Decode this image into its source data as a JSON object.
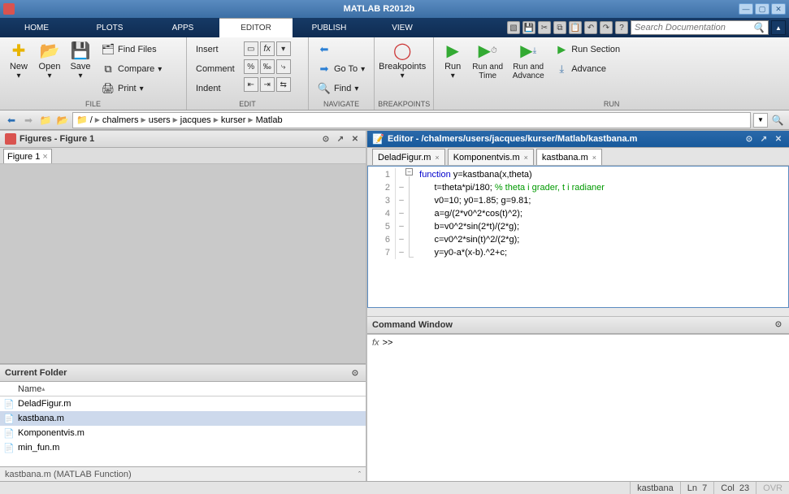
{
  "title": "MATLAB R2012b",
  "tabs": {
    "home": "HOME",
    "plots": "PLOTS",
    "apps": "APPS",
    "editor": "EDITOR",
    "publish": "PUBLISH",
    "view": "VIEW"
  },
  "search": {
    "placeholder": "Search Documentation"
  },
  "ribbon": {
    "file": {
      "new": "New",
      "open": "Open",
      "save": "Save",
      "findfiles": "Find Files",
      "compare": "Compare",
      "print": "Print",
      "label": "FILE"
    },
    "edit": {
      "insert": "Insert",
      "comment": "Comment",
      "indent": "Indent",
      "label": "EDIT"
    },
    "navigate": {
      "goto": "Go To",
      "find": "Find",
      "label": "NAVIGATE"
    },
    "breakpoints": {
      "breakpoints": "Breakpoints",
      "label": "BREAKPOINTS"
    },
    "run": {
      "run": "Run",
      "runtime": "Run and\nTime",
      "runadv": "Run and\nAdvance",
      "runsection": "Run Section",
      "advance": "Advance",
      "label": "RUN"
    }
  },
  "breadcrumb": [
    "/",
    "chalmers",
    "users",
    "jacques",
    "kurser",
    "Matlab"
  ],
  "figures": {
    "title": "Figures - Figure 1",
    "tab": "Figure 1"
  },
  "editor": {
    "title": "Editor - /chalmers/users/jacques/kurser/Matlab/kastbana.m",
    "tabs": [
      {
        "label": "DeladFigur.m",
        "active": false
      },
      {
        "label": "Komponentvis.m",
        "active": false
      },
      {
        "label": "kastbana.m",
        "active": true
      }
    ],
    "lines": [
      {
        "n": 1,
        "pre": "",
        "kw": "function",
        "rest": " y=kastbana(x,theta)",
        "cmt": ""
      },
      {
        "n": 2,
        "pre": "      ",
        "kw": "",
        "rest": "t=theta*pi/180; ",
        "cmt": "% theta i grader, t i radianer"
      },
      {
        "n": 3,
        "pre": "      ",
        "kw": "",
        "rest": "v0=10; y0=1.85; g=9.81;",
        "cmt": ""
      },
      {
        "n": 4,
        "pre": "      ",
        "kw": "",
        "rest": "a=g/(2*v0^2*cos(t)^2);",
        "cmt": ""
      },
      {
        "n": 5,
        "pre": "      ",
        "kw": "",
        "rest": "b=v0^2*sin(2*t)/(2*g);",
        "cmt": ""
      },
      {
        "n": 6,
        "pre": "      ",
        "kw": "",
        "rest": "c=v0^2*sin(t)^2/(2*g);",
        "cmt": ""
      },
      {
        "n": 7,
        "pre": "      ",
        "kw": "",
        "rest": "y=y0-a*(x-b).^2+c;",
        "cmt": ""
      }
    ]
  },
  "currentfolder": {
    "title": "Current Folder",
    "col": "Name",
    "files": [
      {
        "name": "DeladFigur.m",
        "sel": false
      },
      {
        "name": "kastbana.m",
        "sel": true
      },
      {
        "name": "Komponentvis.m",
        "sel": false
      },
      {
        "name": "min_fun.m",
        "sel": false
      }
    ],
    "status": "kastbana.m (MATLAB Function)"
  },
  "command": {
    "title": "Command Window",
    "prompt": ">>"
  },
  "status": {
    "file": "kastbana",
    "ln": "Ln",
    "lnv": "7",
    "col": "Col",
    "colv": "23",
    "ovr": "OVR"
  }
}
